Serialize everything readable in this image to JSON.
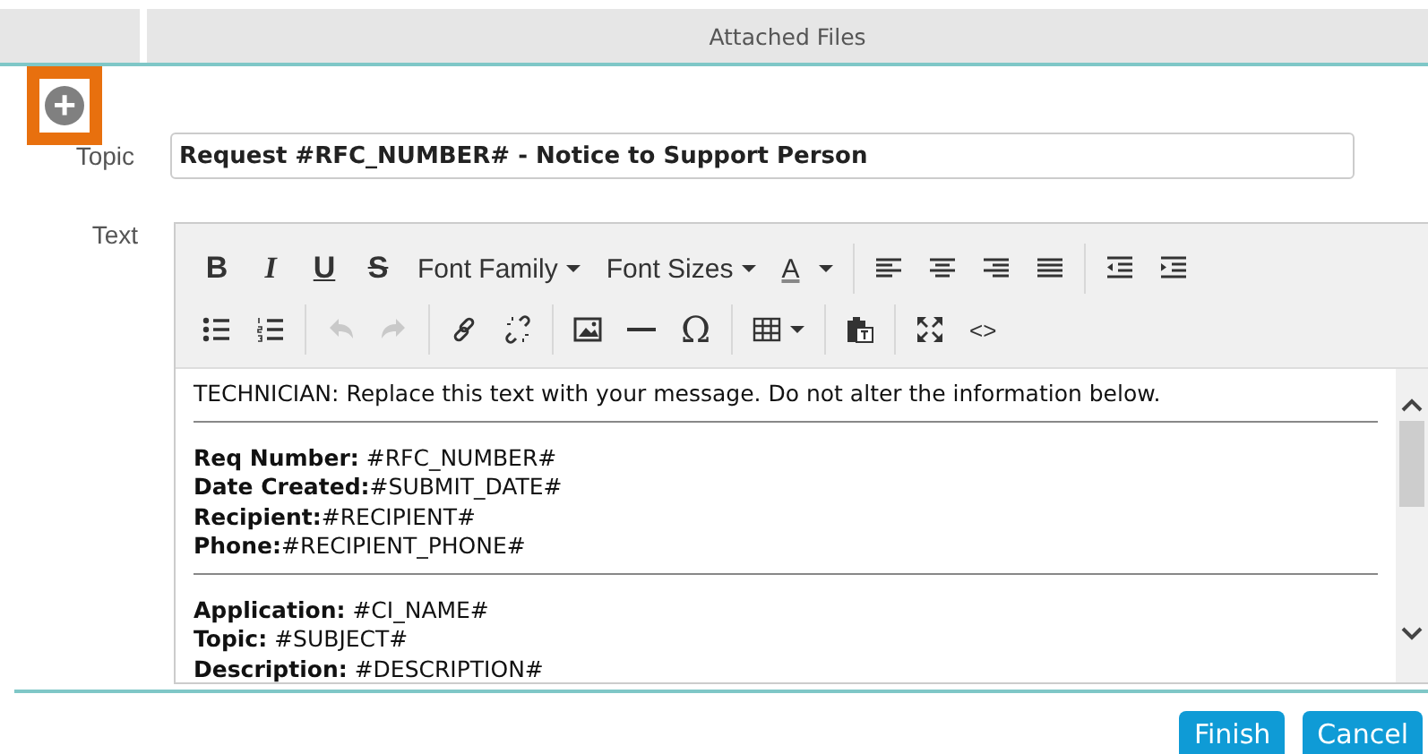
{
  "tabs": [
    {
      "selected": false
    },
    {
      "label": "Attached Files",
      "selected": false
    }
  ],
  "add_button": {
    "label": "+"
  },
  "topic": {
    "label": "Topic",
    "value": "Request #RFC_NUMBER# - Notice to Support Person"
  },
  "text_label": "Text",
  "toolbar": [
    [
      {
        "kind": "bold",
        "label": "B"
      },
      {
        "kind": "italic",
        "label": "I"
      },
      {
        "kind": "underline",
        "label": "U"
      },
      {
        "kind": "strike",
        "label": "S"
      },
      {
        "kind": "dropdown",
        "label": "Font Family"
      },
      {
        "kind": "dropdown",
        "label": "Font Sizes"
      },
      {
        "kind": "forecolor",
        "label": "A"
      },
      {
        "kind": "separator"
      },
      {
        "kind": "align-left"
      },
      {
        "kind": "align-center"
      },
      {
        "kind": "align-right"
      },
      {
        "kind": "justify"
      },
      {
        "kind": "separator"
      },
      {
        "kind": "outdent"
      },
      {
        "kind": "indent"
      }
    ],
    [
      {
        "kind": "bullets"
      },
      {
        "kind": "numbers"
      },
      {
        "kind": "separator"
      },
      {
        "kind": "undo",
        "disabled": true
      },
      {
        "kind": "redo",
        "disabled": true
      },
      {
        "kind": "separator"
      },
      {
        "kind": "link"
      },
      {
        "kind": "unlink"
      },
      {
        "kind": "separator"
      },
      {
        "kind": "image"
      },
      {
        "kind": "rule"
      },
      {
        "kind": "symbol",
        "label": "Ω"
      },
      {
        "kind": "separator"
      },
      {
        "kind": "table"
      },
      {
        "kind": "separator"
      },
      {
        "kind": "paste"
      },
      {
        "kind": "separator"
      },
      {
        "kind": "fullscreen"
      },
      {
        "kind": "code",
        "label": "<>"
      }
    ]
  ],
  "content": [
    {
      "kind": "line",
      "text": "TECHNICIAN: Replace this text with your message. Do not alter the information below."
    },
    {
      "kind": "rule"
    },
    {
      "kind": "line",
      "text": "**Req Number:** #RFC_NUMBER#"
    },
    {
      "kind": "line",
      "text": "**Date Created:**#SUBMIT_DATE#"
    },
    {
      "kind": "line",
      "text": "**Recipient:**#RECIPIENT#"
    },
    {
      "kind": "line",
      "text": "**Phone:**#RECIPIENT_PHONE#"
    },
    {
      "kind": "rule"
    },
    {
      "kind": "line",
      "text": "**Application:** #CI_NAME#"
    },
    {
      "kind": "line",
      "text": "**Topic:** #SUBJECT#"
    },
    {
      "kind": "line",
      "text": "**Description:** #DESCRIPTION#"
    }
  ],
  "buttons": [
    {
      "label": "Finish"
    },
    {
      "label": "Cancel"
    }
  ]
}
